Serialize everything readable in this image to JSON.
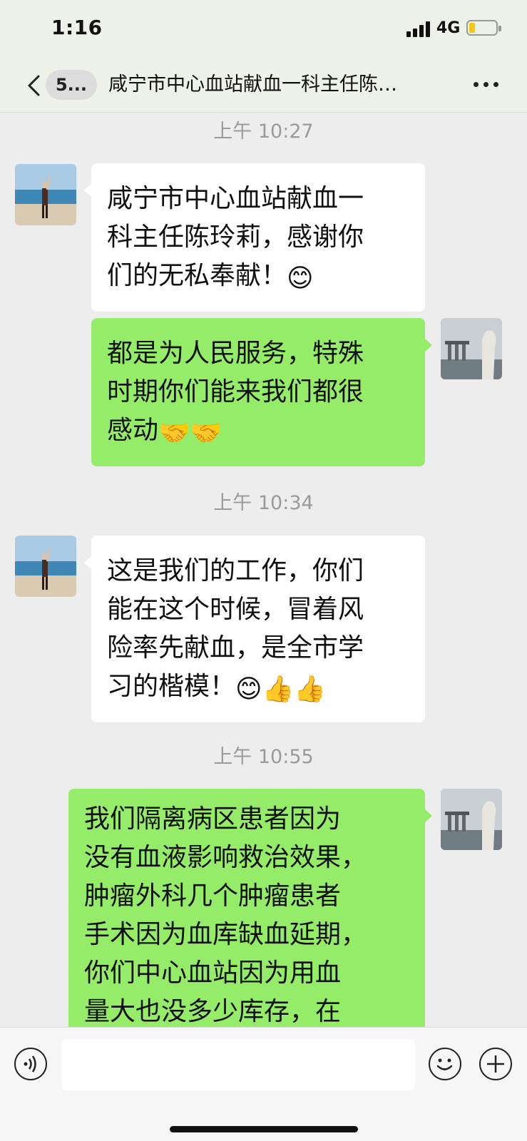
{
  "status_bar": {
    "time": "1:16",
    "network": "4G"
  },
  "nav": {
    "unread_count": "5...",
    "title": "咸宁市中心血站献血一科主任陈…"
  },
  "messages": [
    {
      "timestamp": "上午 10:27"
    },
    {
      "side": "left",
      "text": "咸宁市中心血站献血一科主任陈玲莉，感谢你们的无私奉献！",
      "emoji": "smiling-face"
    },
    {
      "side": "right",
      "text": "都是为人民服务，特殊时期你们能来我们都很感动",
      "emoji": "handshake x2"
    },
    {
      "timestamp": "上午 10:34"
    },
    {
      "side": "left",
      "text": "这是我们的工作，你们能在这个时候，冒着风险率先献血，是全市学习的楷模！",
      "emoji": "smiling-face, thumbs-up x2"
    },
    {
      "timestamp": "上午 10:55"
    },
    {
      "side": "right",
      "text": "我们隔离病区患者因为没有血液影响救治效果，肿瘤外科几个肿瘤患者手术因为血库缺血延期，你们中心血站因为用血量大也没多少库存，在"
    }
  ],
  "ui": {
    "m1_lines": [
      "咸宁市中心血站献血一",
      "科主任陈玲莉，感谢你",
      "们的无私奉献！"
    ],
    "m2_lines": [
      "都是为人民服务，特殊",
      "时期你们能来我们都很",
      "感动"
    ],
    "m3_lines": [
      "这是我们的工作，你们",
      "能在这个时候，冒着风",
      "险率先献血，是全市学",
      "习的楷模！"
    ],
    "m4_lines": [
      "我们隔离病区患者因为",
      "没有血液影响救治效果，",
      "肿瘤外科几个肿瘤患者",
      "手术因为血库缺血延期，",
      "你们中心血站因为用血",
      "量大也没多少库存，在"
    ],
    "glyphs": {
      "smile": "😊",
      "handshake": "🤝",
      "thumbs": "👍"
    }
  },
  "colors": {
    "background": "#ededed",
    "sent_bubble": "#95ec69",
    "received_bubble": "#ffffff",
    "battery": "#f5c518"
  }
}
